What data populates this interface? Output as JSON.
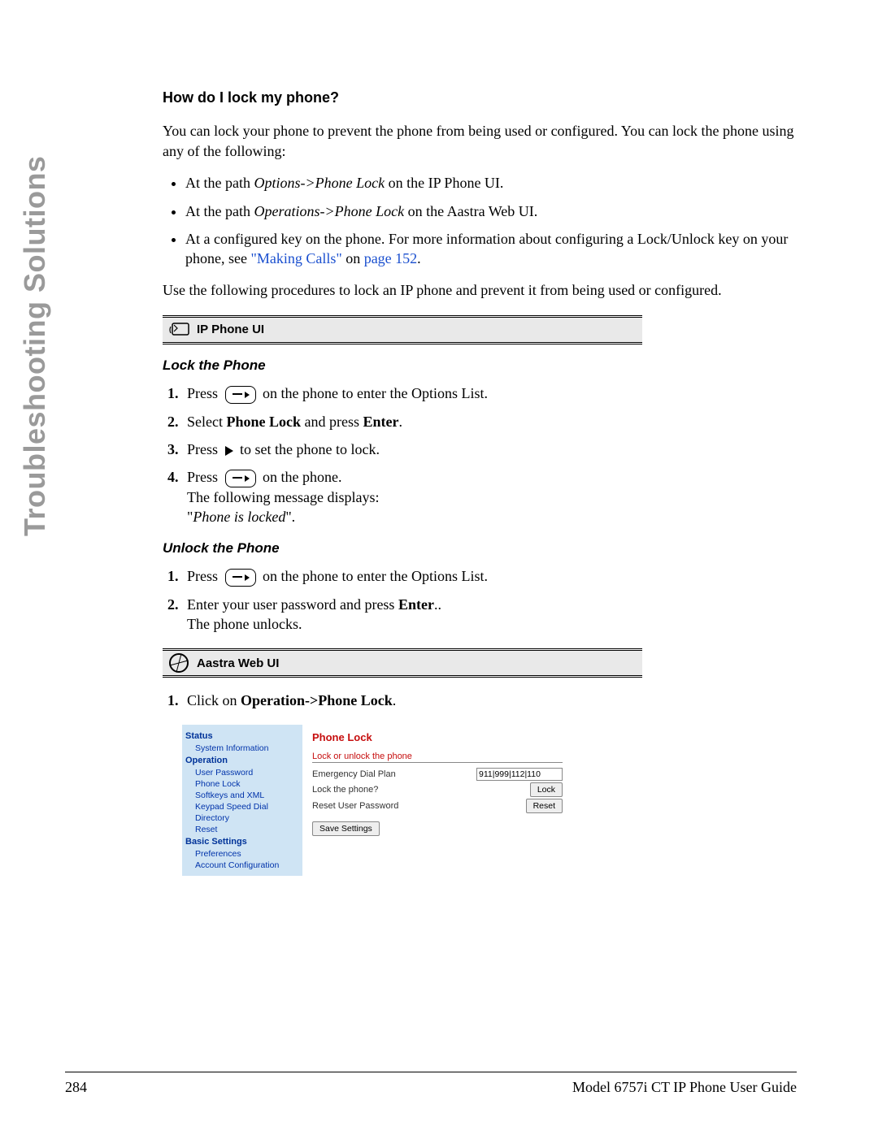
{
  "sidebar_title": "Troubleshooting Solutions",
  "question": "How do I lock my phone?",
  "intro": "You can lock your phone to prevent the phone from being used or configured. You can lock the phone using any of the following:",
  "bullets": {
    "b1_pre": "At the path ",
    "b1_em": "Options->Phone Lock",
    "b1_post": " on the IP Phone UI.",
    "b2_pre": "At the path ",
    "b2_em": "Operations->Phone Lock",
    "b2_post": " on the Aastra Web UI.",
    "b3_pre": "At a configured key on the phone. For more information about configuring a Lock/Unlock key on your phone, see ",
    "b3_link1": "\"Making Calls\"",
    "b3_mid": " on ",
    "b3_link2": "page 152",
    "b3_post": "."
  },
  "intro2": "Use the following procedures to lock an IP phone and prevent it from being used or configured.",
  "ipui_header": "IP Phone UI",
  "lock_title": "Lock the Phone",
  "lock": {
    "s1a": "Press ",
    "s1b": " on the phone to enter the Options List.",
    "s2a": "Select ",
    "s2b": "Phone Lock",
    "s2c": " and press ",
    "s2d": "Enter",
    "s2e": ".",
    "s3a": "Press ",
    "s3b": " to set the phone to lock.",
    "s4a": "Press ",
    "s4b": " on the phone.",
    "s4c": "The following message displays:",
    "s4d": "\"",
    "s4e": "Phone is locked",
    "s4f": "\"."
  },
  "unlock_title": "Unlock the Phone",
  "unlock": {
    "s1a": "Press ",
    "s1b": " on the phone to enter the Options List.",
    "s2a": "Enter your user password and press ",
    "s2b": "Enter",
    "s2c": "..",
    "s2d": "The phone unlocks."
  },
  "webui_header": "Aastra Web UI",
  "web_step1a": "Click on ",
  "web_step1b": "Operation->Phone Lock",
  "web_step1c": ".",
  "webui": {
    "nav": {
      "status": "Status",
      "sysinfo": "System Information",
      "operation": "Operation",
      "userpw": "User Password",
      "phonelock": "Phone Lock",
      "softxml": "Softkeys and XML",
      "speed": "Keypad Speed Dial",
      "directory": "Directory",
      "reset": "Reset",
      "basic": "Basic Settings",
      "prefs": "Preferences",
      "acct": "Account Configuration"
    },
    "panel": {
      "title": "Phone Lock",
      "sub": "Lock or unlock the phone",
      "edp": "Emergency Dial Plan",
      "edp_val": "911|999|112|110",
      "lockq": "Lock the phone?",
      "lockbtn": "Lock",
      "resetpw": "Reset User Password",
      "resetbtn": "Reset",
      "save": "Save Settings"
    }
  },
  "footer": {
    "page": "284",
    "guide": "Model 6757i CT IP Phone User Guide"
  }
}
